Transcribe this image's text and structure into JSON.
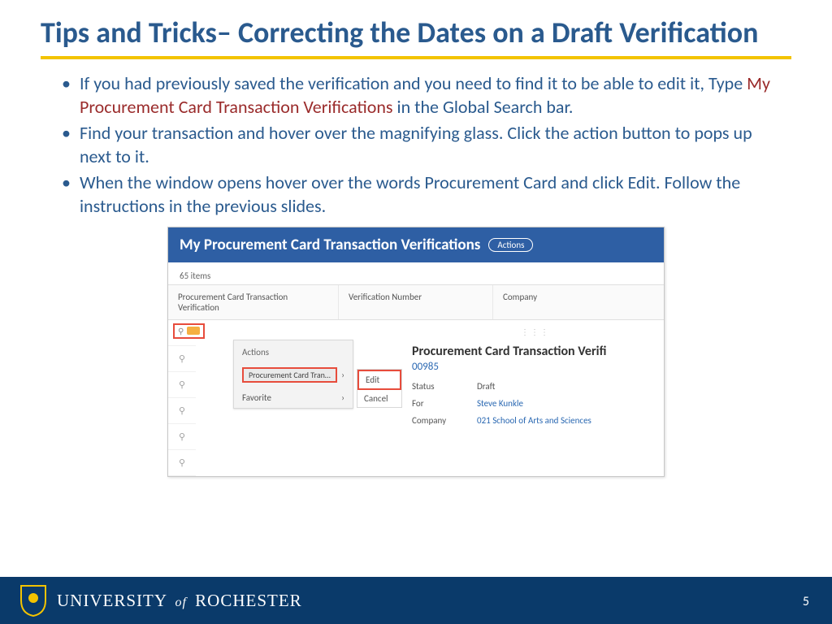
{
  "title": {
    "bold": "Tips and Tricks– ",
    "rest": "Correcting the Dates on a Draft Verification"
  },
  "bullets": [
    {
      "pre": "If you had previously saved the verification and you need to find it to be able to edit it, Type ",
      "hl": "My Procurement Card Transaction Verifications",
      "post": " in the Global Search bar."
    },
    {
      "pre": "Find your transaction and hover over the magnifying glass.  Click the action button to pops up next to it.",
      "hl": "",
      "post": ""
    },
    {
      "pre": "When the window opens hover over the words Procurement Card and click Edit.  Follow the instructions in the previous slides.",
      "hl": "",
      "post": ""
    }
  ],
  "app": {
    "title": "My Procurement Card Transaction Verifications",
    "actions_pill": "Actions",
    "items_count": "65 items",
    "columns": {
      "a": "Procurement Card Transaction Verification",
      "b": "Verification Number",
      "c": "Company"
    },
    "actions_menu": {
      "header": "Actions",
      "row1": "Procurement Card Tran…",
      "row2": "Favorite",
      "chevron": "›"
    },
    "submenu": {
      "edit": "Edit",
      "cancel": "Cancel"
    },
    "detail": {
      "title": "Procurement Card Transaction Verifi",
      "link": "00985",
      "status_k": "Status",
      "status_v": "Draft",
      "for_k": "For",
      "for_v": "Steve Kunkle",
      "company_k": "Company",
      "company_v": "021 School of Arts and Sciences"
    }
  },
  "footer": {
    "university_1": "UNIVERSITY",
    "university_of": "of",
    "university_2": "ROCHESTER",
    "page": "5"
  }
}
